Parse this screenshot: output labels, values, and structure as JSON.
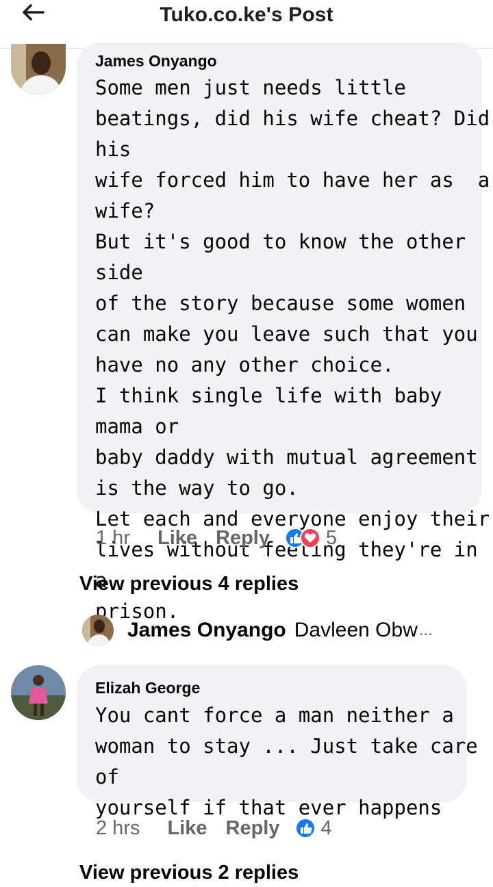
{
  "header": {
    "title": "Tuko.co.ke's Post",
    "back_icon": "back-arrow-icon"
  },
  "comments": [
    {
      "author": "James Onyango",
      "text": "Some men just needs little\nbeatings, did his wife cheat? Did his\nwife forced him to have her as  a\nwife?\nBut it's good to know the other side\nof the story because some women\ncan make you leave such that you\nhave no any other choice.\nI think single life with baby mama or\nbaby daddy with mutual agreement\nis the way to go.\nLet each and everyone enjoy their\nlives without feeling they're in a\nprison.",
      "time": "1 hr",
      "like_label": "Like",
      "reply_label": "Reply",
      "reactions": [
        "like",
        "love"
      ],
      "reaction_count": "5",
      "view_replies": "View previous 4 replies",
      "reply_preview": {
        "author": "James Onyango",
        "text": "Davleen Obw",
        "ellipsis": "..."
      }
    },
    {
      "author": "Elizah George",
      "text": "You cant force a man neither a\nwoman to stay ... Just take care of\nyourself if that ever happens",
      "time": "2 hrs",
      "like_label": "Like",
      "reply_label": "Reply",
      "reactions": [
        "like"
      ],
      "reaction_count": "4",
      "view_replies": "View previous 2 replies"
    }
  ],
  "colors": {
    "like_blue": "#1877f2",
    "love_red": "#f33e58",
    "bubble": "#f0f2f5",
    "meta": "#65676b"
  }
}
